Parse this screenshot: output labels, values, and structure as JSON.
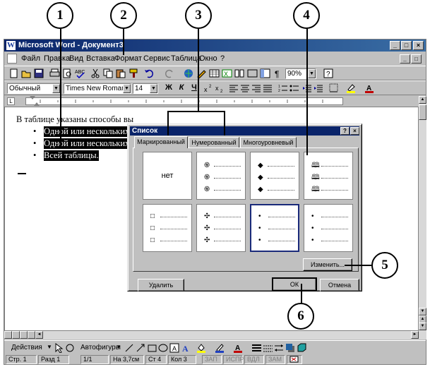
{
  "window": {
    "title": "Microsoft Word - Документ3",
    "app_icon": "W",
    "title_buttons": [
      "_",
      "□",
      "×"
    ],
    "doc_buttons": [
      "_",
      "□",
      "×"
    ]
  },
  "menu": {
    "items": [
      {
        "label": "Файл"
      },
      {
        "label": "Правка"
      },
      {
        "label": "Вид"
      },
      {
        "label": "Вставка"
      },
      {
        "label": "Формат"
      },
      {
        "label": "Сервис"
      },
      {
        "label": "Таблица"
      },
      {
        "label": "Окно"
      },
      {
        "label": "?"
      }
    ]
  },
  "standard_toolbar": {
    "zoom": "90%"
  },
  "format_toolbar": {
    "style": "Обычный",
    "font": "Times New Roman",
    "size": "14",
    "bold": "Ж",
    "italic": "К",
    "underline": "Ч"
  },
  "document": {
    "lead_text": "В таблице указаны способы вы",
    "items": [
      "Одной или нескольких",
      "Одной или нескольких",
      "Всей таблицы."
    ],
    "bullet": "•"
  },
  "dialog": {
    "title": "Список",
    "help": "?",
    "close": "×",
    "tabs": [
      {
        "label": "Маркированный",
        "active": true
      },
      {
        "label": "Нумерованный",
        "active": false
      },
      {
        "label": "Многоуровневый",
        "active": false
      }
    ],
    "none_label": "нет",
    "bullet_styles": [
      {
        "symbol": "none-icon",
        "glyph": ""
      },
      {
        "symbol": "curl-icon",
        "glyph": "֍"
      },
      {
        "symbol": "diamond-icon",
        "glyph": "◆"
      },
      {
        "symbol": "book-icon",
        "glyph": "🕮"
      },
      {
        "symbol": "square-icon",
        "glyph": "□"
      },
      {
        "symbol": "four-diamond-icon",
        "glyph": "✣"
      },
      {
        "symbol": "dot-icon",
        "glyph": "•",
        "selected": true
      },
      {
        "symbol": "dot-icon",
        "glyph": "•"
      }
    ],
    "change_button": "Изменить...",
    "remove_button": "Удалить",
    "ok_button": "ОК",
    "cancel_button": "Отмена"
  },
  "drawing_toolbar": {
    "actions": "Действия",
    "autoshapes": "Автофигуры"
  },
  "status_bar": {
    "page": "Стр. 1",
    "section": "Разд 1",
    "pages": "1/1",
    "at": "На 3,7см",
    "line": "Ст 4",
    "col": "Кол 3",
    "modes": [
      "ЗАП",
      "ИСПР",
      "ВДЛ",
      "ЗАМ"
    ]
  },
  "callouts": [
    "1",
    "2",
    "3",
    "4",
    "5",
    "6"
  ]
}
